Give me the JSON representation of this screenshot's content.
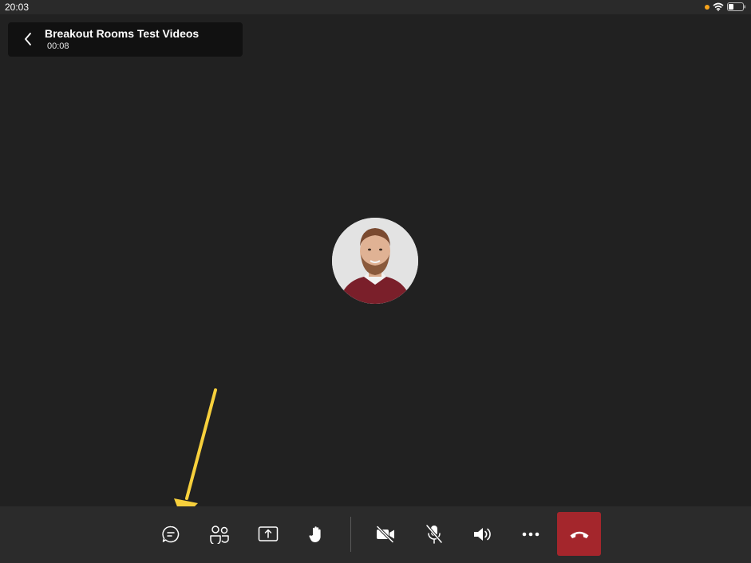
{
  "status_bar": {
    "time": "20:03",
    "icons": [
      "recording-dot-icon",
      "wifi-icon",
      "battery-icon"
    ]
  },
  "meeting": {
    "title": "Breakout Rooms Test Videos",
    "elapsed": "00:08"
  },
  "participant": {
    "avatar": "participant-avatar"
  },
  "toolbar": {
    "buttons": [
      {
        "name": "chat",
        "icon": "chat-icon"
      },
      {
        "name": "participants",
        "icon": "people-icon"
      },
      {
        "name": "share",
        "icon": "share-screen-icon"
      },
      {
        "name": "raise-hand",
        "icon": "hand-icon"
      },
      {
        "name": "camera",
        "icon": "camera-off-icon",
        "state": "off"
      },
      {
        "name": "microphone",
        "icon": "mic-off-icon",
        "state": "muted"
      },
      {
        "name": "speaker",
        "icon": "speaker-icon"
      },
      {
        "name": "more",
        "icon": "more-icon"
      },
      {
        "name": "hang-up",
        "icon": "hang-up-icon"
      }
    ]
  },
  "colors": {
    "background": "#212121",
    "toolbar": "#2b2b2b",
    "hang_up": "#a4262c",
    "annotation_arrow": "#f7d03c",
    "recording_dot": "#f7a31b"
  }
}
